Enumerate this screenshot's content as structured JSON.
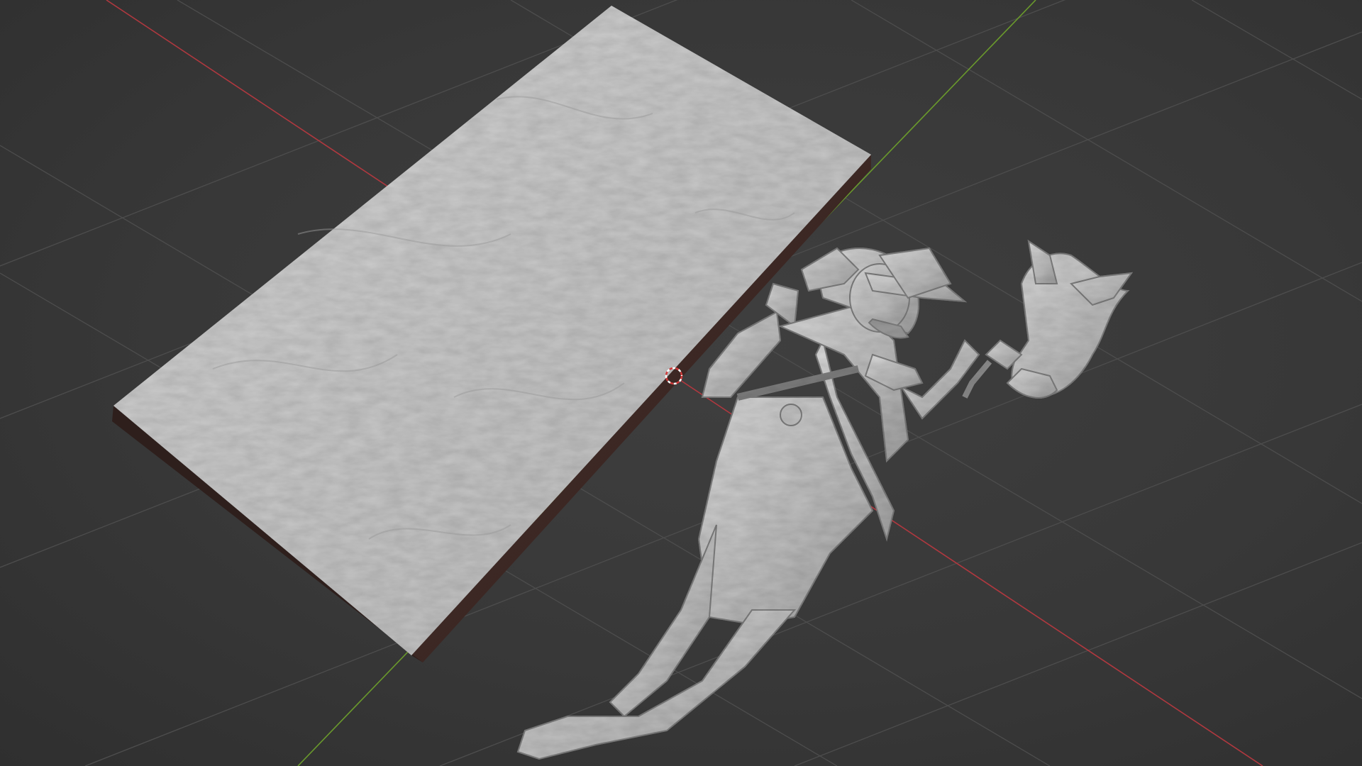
{
  "viewport": {
    "background": "#3a3a3a",
    "grid_color": "#4d4d4d",
    "x_axis_color": "#b0383f",
    "y_axis_color": "#6a9a2c",
    "object_color": "#c9c9c9",
    "base_side_color": "#3f2a26",
    "origin_marker_color": "#d23a3a"
  },
  "scene": {
    "objects": [
      {
        "name": "textured-base-slab",
        "icon": "mesh-icon"
      },
      {
        "name": "cowboy-figure",
        "icon": "mesh-icon"
      },
      {
        "name": "horse-head",
        "icon": "mesh-icon"
      }
    ],
    "cursor": "3d-cursor-icon"
  }
}
